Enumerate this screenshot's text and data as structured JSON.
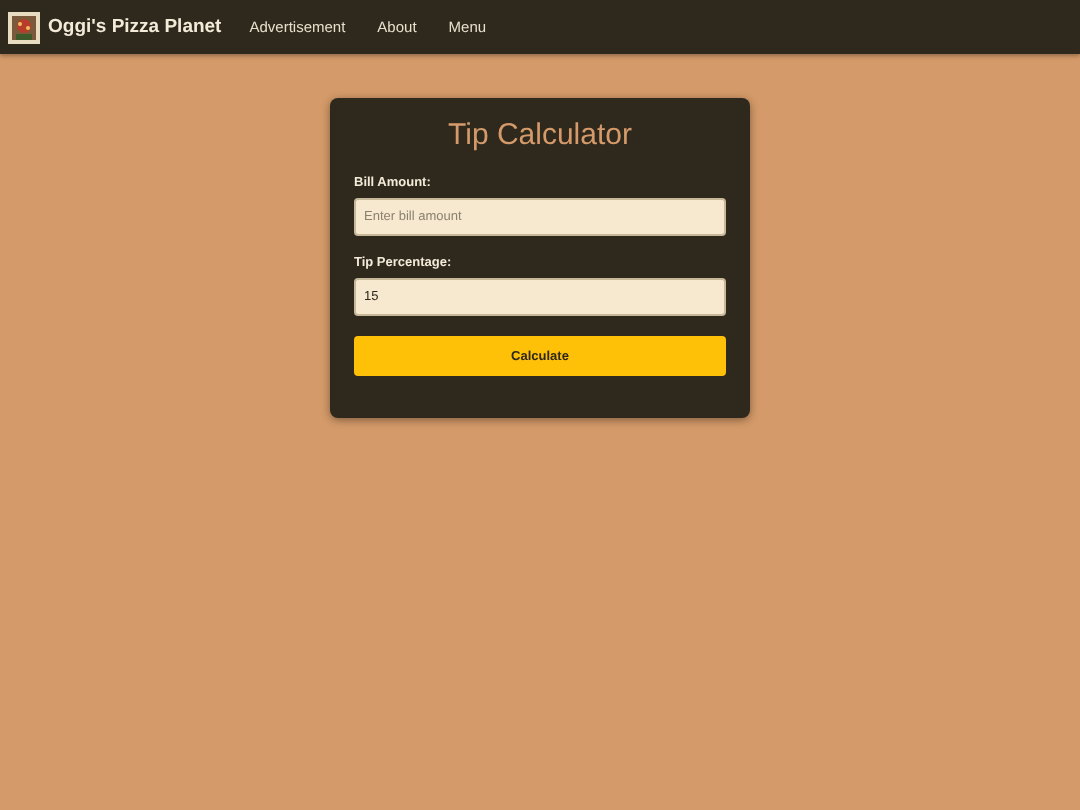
{
  "navbar": {
    "brand": "Oggi's Pizza Planet",
    "links": [
      "Advertisement",
      "About",
      "Menu"
    ]
  },
  "calculator": {
    "title": "Tip Calculator",
    "fields": [
      {
        "label": "Bill Amount:",
        "placeholder": "Enter bill amount"
      },
      {
        "label": "Tip Percentage:",
        "value": "15"
      }
    ],
    "button": "Calculate"
  }
}
